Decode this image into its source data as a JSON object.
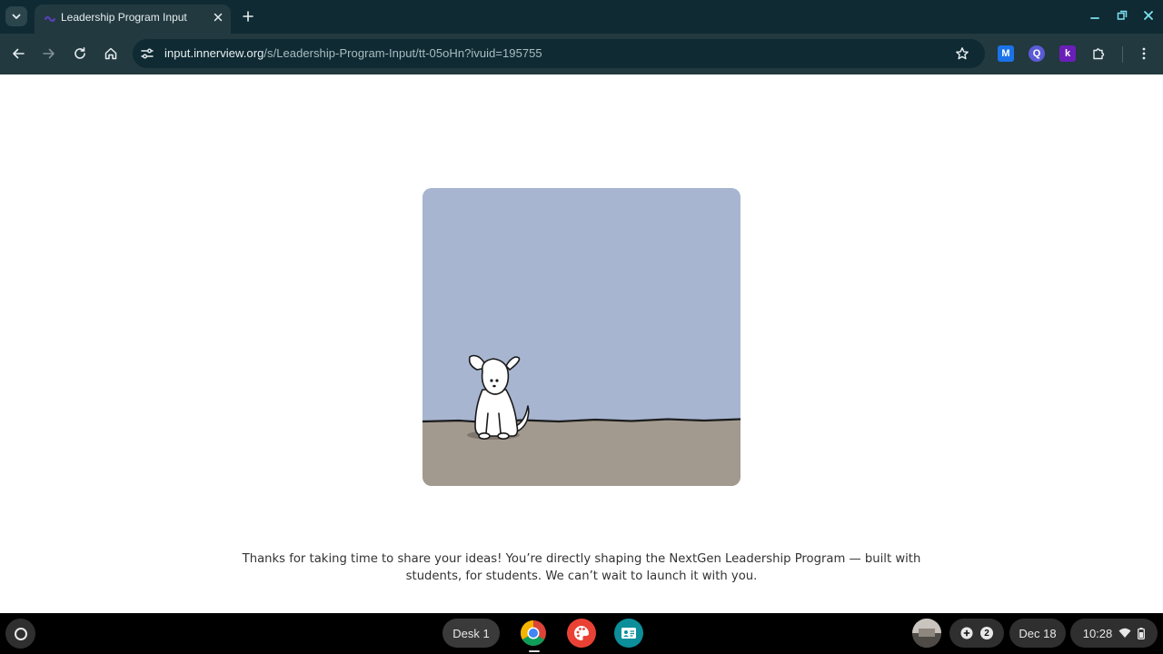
{
  "browser": {
    "tab_title": "Leadership Program Input",
    "url_host": "input.innerview.org",
    "url_path": "/s/Leadership-Program-Input/tt-05oHn?ivuid=195755"
  },
  "extensions": [
    {
      "name": "ext-m",
      "letter": "M",
      "color": "#1a73e8"
    },
    {
      "name": "ext-q",
      "letter": "Q",
      "color": "#5b5bd6"
    },
    {
      "name": "ext-k",
      "letter": "k",
      "color": "#6a1fb8"
    }
  ],
  "page": {
    "message_line1": "Thanks for taking  time to share your ideas! You’re directly shaping the NextGen Leadership Program — built with",
    "message_line2": "students, for students. We can’t wait to launch it with you.",
    "illustration": {
      "sky_color": "#a7b5d1",
      "ground_color": "#a39a8f"
    }
  },
  "shelf": {
    "desk_label": "Desk 1",
    "notification_count": "2",
    "date": "Dec 18",
    "time": "10:28"
  }
}
